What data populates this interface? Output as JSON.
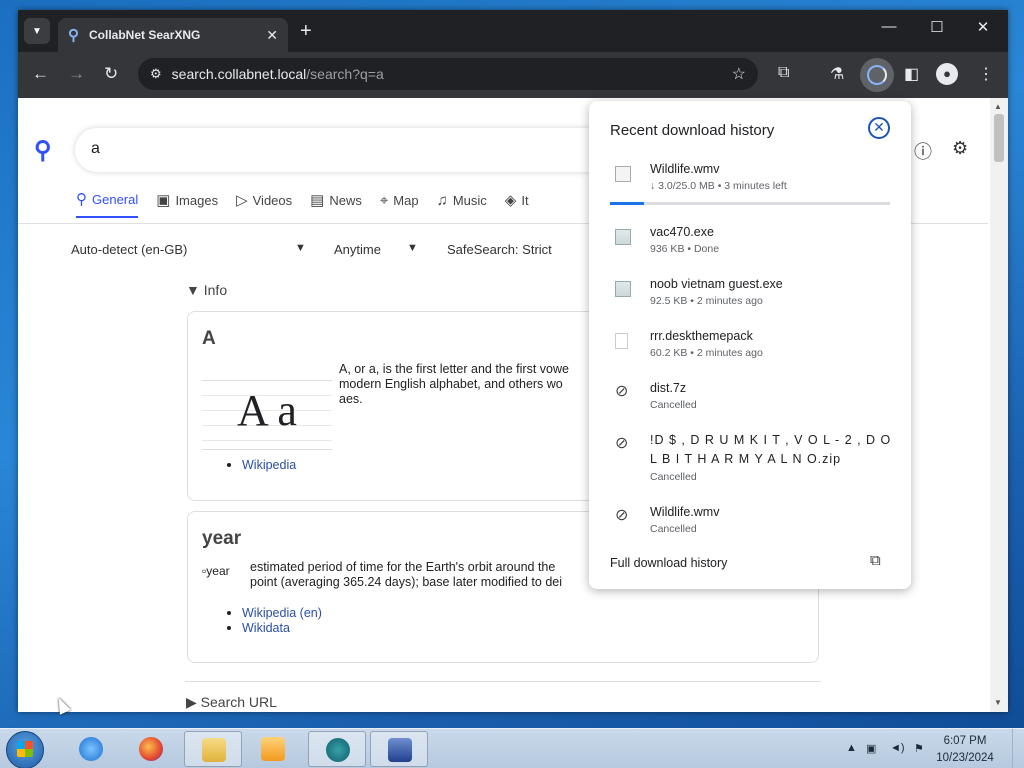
{
  "browser": {
    "tab_title": "CollabNet SearXNG",
    "tab_close": "✕",
    "new_tab": "+",
    "url_host": "search.collabnet.local",
    "url_path": "/search?q=a"
  },
  "search": {
    "query": "a",
    "categories": [
      "General",
      "Images",
      "Videos",
      "News",
      "Map",
      "Music",
      "It"
    ],
    "active_category": "General",
    "language": "Auto-detect (en-GB)",
    "time_range": "Anytime",
    "safesearch": "SafeSearch: Strict"
  },
  "results": {
    "info_toggle": "Info",
    "card_a": {
      "title": "A",
      "image_text": "A a",
      "text": "A, or a, is the first letter and the first vowel letter of the Latin alphabet, used in the modern English alphabet, and others wo... aes.",
      "text_visible": "A, or a, is the first letter and the first vowe modern English alphabet, and others wo aes.",
      "link": "Wikipedia"
    },
    "card_year": {
      "title": "year",
      "img_alt": "year",
      "text": "estimated period of time for the Earth's orbit around the point (averaging 365.24 days); base later modified to dei",
      "links": [
        "Wikipedia (en)",
        "Wikidata"
      ]
    },
    "search_url_toggle": "Search URL"
  },
  "downloads_panel": {
    "title": "Recent download history",
    "items": [
      {
        "name": "Wildlife.wmv",
        "status": "↓ 3.0/25.0 MB • 3 minutes left",
        "icon": "video-file-icon",
        "progress": 0.12
      },
      {
        "name": "vac470.exe",
        "status": "936 KB • Done",
        "icon": "exe-file-icon"
      },
      {
        "name": "noob vietnam guest.exe",
        "status": "92.5 KB • 2 minutes ago",
        "icon": "exe-file-icon"
      },
      {
        "name": "rrr.deskthemepack",
        "status": "60.2 KB • 2 minutes ago",
        "icon": "file-icon"
      },
      {
        "name": "dist.7z",
        "status": "Cancelled",
        "icon": "download-off-icon"
      },
      {
        "name": "!D $ , D R U M K I T , V O L - 2 , D O L B I T H A R M Y A L N O.zip",
        "status": "Cancelled",
        "icon": "download-off-icon"
      },
      {
        "name": "Wildlife.wmv",
        "status": "Cancelled",
        "icon": "download-off-icon"
      }
    ],
    "full_history": "Full download history"
  },
  "taskbar": {
    "time": "6:07 PM",
    "date": "10/23/2024"
  },
  "colors": {
    "accent": "#3050ff",
    "chrome_dark": "#202124",
    "chrome_toolbar": "#35363a",
    "progress": "#1a73e8"
  }
}
